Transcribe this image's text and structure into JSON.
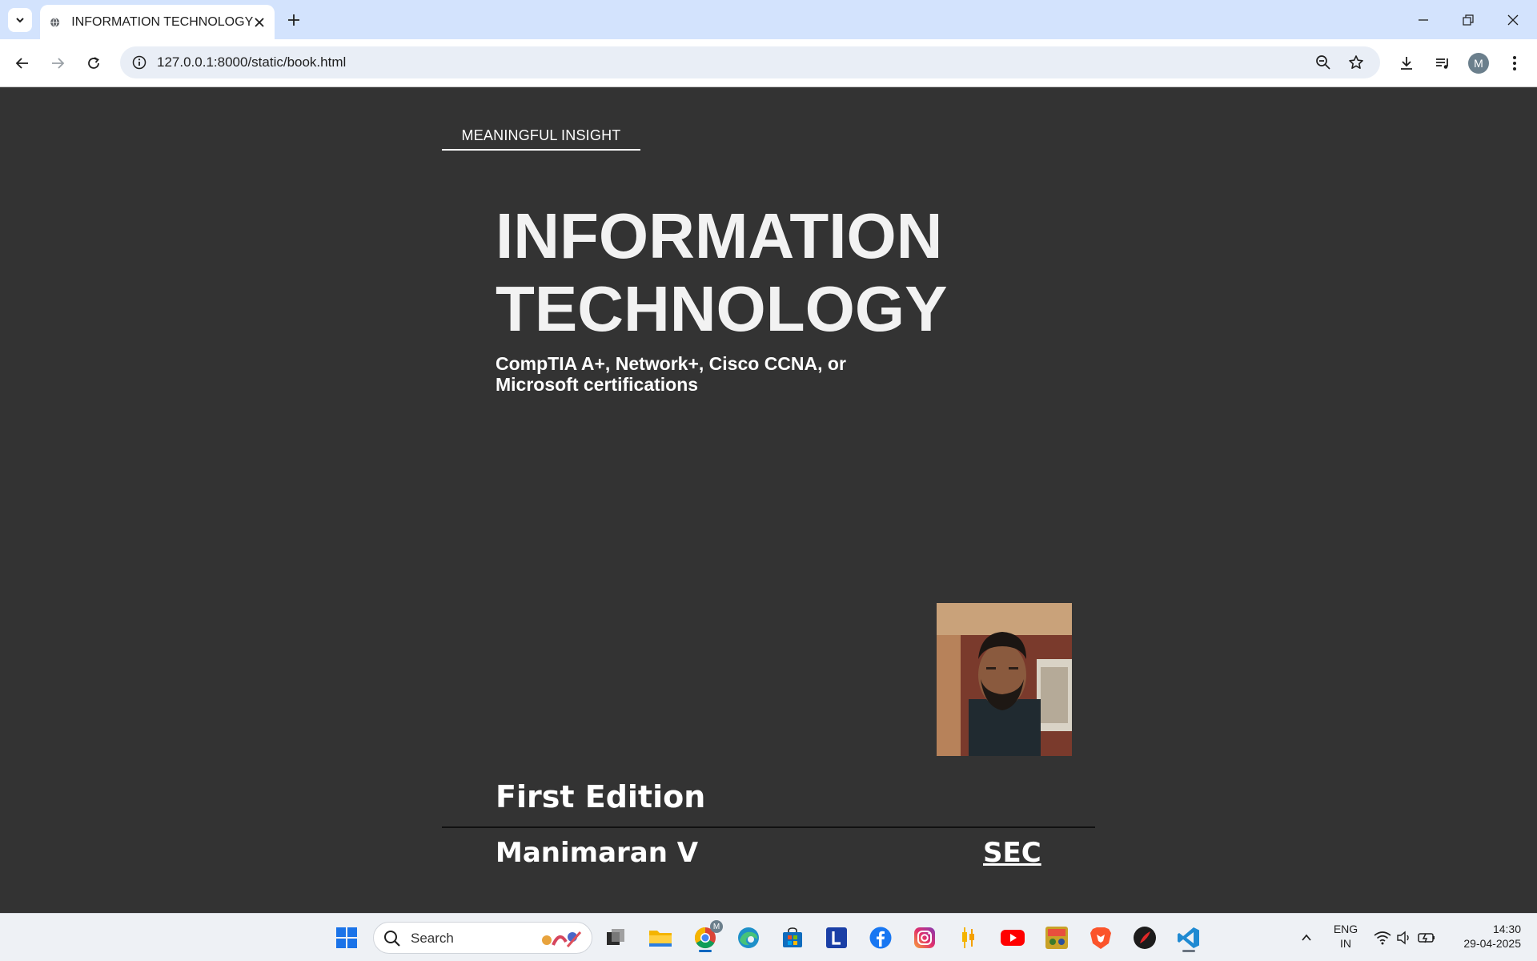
{
  "browser": {
    "tab_title": "INFORMATION TECHNOLOGY",
    "url": "127.0.0.1:8000/static/book.html",
    "profile_initial": "M"
  },
  "book": {
    "kicker": "MEANINGFUL INSIGHT",
    "title_line1": "INFORMATION",
    "title_line2": "TECHNOLOGY",
    "subtitle_line1": "CompTIA A+, Network+, Cisco CCNA, or",
    "subtitle_line2": "Microsoft certifications",
    "edition": "First Edition",
    "author": "Manimaran V",
    "publisher": "SEC"
  },
  "taskbar": {
    "search_placeholder": "Search",
    "language_line1": "ENG",
    "language_line2": "IN",
    "time": "14:30",
    "date": "29-04-2025",
    "chrome_badge": "M"
  },
  "colors": {
    "page_background": "#333333",
    "tabbar": "#d3e3fd",
    "accent": "#0067c0"
  }
}
